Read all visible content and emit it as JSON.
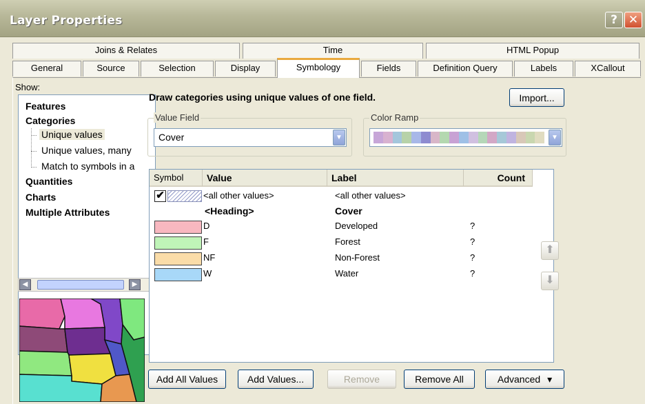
{
  "window": {
    "title": "Layer Properties",
    "help_label": "?",
    "close_label": "✕"
  },
  "tabs_row_back": [
    "Joins & Relates",
    "Time",
    "HTML Popup"
  ],
  "tabs_row_front": [
    "General",
    "Source",
    "Selection",
    "Display",
    "Symbology",
    "Fields",
    "Definition Query",
    "Labels",
    "XCallout"
  ],
  "active_tab": "Symbology",
  "show": {
    "label": "Show:",
    "items": [
      "Features",
      "Categories",
      "Unique values",
      "Unique values, many",
      "Match to symbols in a",
      "Quantities",
      "Charts",
      "Multiple Attributes"
    ],
    "selected": "Unique values"
  },
  "heading": "Draw categories using unique values of one field.",
  "import_label": "Import...",
  "value_field": {
    "label": "Value Field",
    "value": "Cover"
  },
  "color_ramp": {
    "label": "Color Ramp",
    "colors": [
      "#C7A6D8",
      "#D8B2D0",
      "#A4C6DC",
      "#B7D2A9",
      "#A8B8E8",
      "#8E8BD0",
      "#D8B6C8",
      "#B4D8B0",
      "#C8A2D4",
      "#9FC0E6",
      "#D0C0E0",
      "#B5D7B8",
      "#D2A8C6",
      "#A6C8D8",
      "#C0B4E0",
      "#D8C8B8",
      "#C9D7B0",
      "#E0DCC0"
    ]
  },
  "table": {
    "headers": {
      "symbol": "Symbol",
      "value": "Value",
      "label": "Label",
      "count": "Count"
    },
    "other": {
      "value": "<all other values>",
      "label": "<all other values>"
    },
    "heading_row": {
      "value": "<Heading>",
      "label": "Cover"
    },
    "rows": [
      {
        "value": "D",
        "label": "Developed",
        "count": "?",
        "color": "#F8B8C0"
      },
      {
        "value": "F",
        "label": "Forest",
        "count": "?",
        "color": "#C0F4B8"
      },
      {
        "value": "NF",
        "label": "Non-Forest",
        "count": "?",
        "color": "#FADCA8"
      },
      {
        "value": "W",
        "label": "Water",
        "count": "?",
        "color": "#A8D8F8"
      }
    ]
  },
  "buttons": {
    "add_all": "Add All Values",
    "add": "Add Values...",
    "remove": "Remove",
    "remove_all": "Remove All",
    "advanced": "Advanced",
    "advanced_caret": "▾"
  },
  "icons": {
    "up": "up-arrow-icon",
    "down": "down-arrow-icon",
    "check": "checkmark-icon"
  }
}
